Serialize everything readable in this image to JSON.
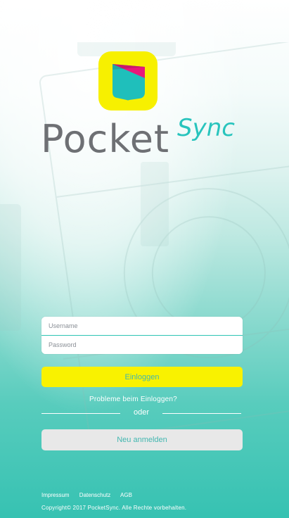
{
  "brand": {
    "name_primary": "Pocket",
    "name_secondary": "Sync",
    "logo_icon": "pocket-icon"
  },
  "login": {
    "username_placeholder": "Username",
    "password_placeholder": "Password",
    "login_label": "Einloggen",
    "help_link": "Probleme beim Einloggen?",
    "or_label": "oder",
    "register_label": "Neu anmelden"
  },
  "footer": {
    "links": [
      "Impressum",
      "Datenschutz",
      "AGB"
    ],
    "copyright": "Copyright© 2017 PocketSync. Alle Rechte vorbehalten."
  },
  "colors": {
    "accent_yellow": "#f9f200",
    "teal": "#2ec3b3",
    "logo_pink": "#e8187a",
    "logo_teal": "#1fbfbb",
    "brand_gray": "#6e7074"
  }
}
